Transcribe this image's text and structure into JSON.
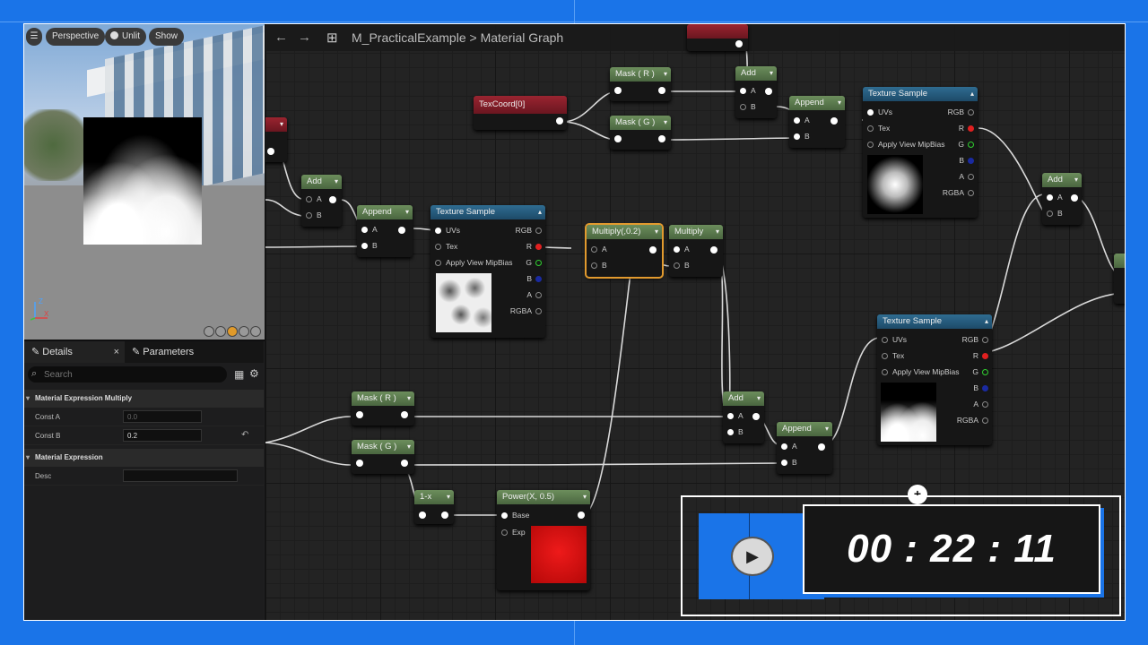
{
  "viewport": {
    "menu_icon": "hamburger-icon",
    "perspective_label": "Perspective",
    "unlit_label": "Unlit",
    "show_label": "Show",
    "axis_z": "Z",
    "axis_x": "X"
  },
  "details": {
    "tab_details": "Details",
    "tab_parameters": "Parameters",
    "close_glyph": "×",
    "search_placeholder": "Search",
    "category_multiply": "Material Expression Multiply",
    "const_a_label": "Const A",
    "const_a_value": "0.0",
    "const_b_label": "Const B",
    "const_b_value": "0.2",
    "category_expression": "Material Expression",
    "desc_label": "Desc",
    "desc_value": ""
  },
  "graph": {
    "asset_name": "M_PracticalExample",
    "separator": ">",
    "graph_name": "Material Graph",
    "nodes": {
      "texcoord": "TexCoord[0]",
      "mask_r_top": "Mask ( R )",
      "mask_g_top": "Mask ( G )",
      "add_top": "Add",
      "append_top": "Append",
      "texsample_top": "Texture Sample",
      "add_right": "Add",
      "add_left": "Add",
      "append_left": "Append",
      "texsample_mid": "Texture Sample",
      "multiply_02": "Multiply(,0.2)",
      "multiply": "Multiply",
      "mask_r_bot": "Mask ( R )",
      "mask_g_bot": "Mask ( G )",
      "one_minus": "1-x",
      "power": "Power(X, 0.5)",
      "add_bot": "Add",
      "append_bot": "Append",
      "texsample_bot": "Texture Sample"
    },
    "pins": {
      "a": "A",
      "b": "B",
      "uvs": "UVs",
      "tex": "Tex",
      "mip": "Apply View MipBias",
      "rgb": "RGB",
      "r": "R",
      "g": "G",
      "bch": "B",
      "alpha": "A",
      "rgba": "RGBA",
      "base": "Base",
      "exp": "Exp"
    }
  },
  "overlay": {
    "timer": "00 : 22 : 11",
    "plus": "+"
  },
  "colors": {
    "brand_blue": "#1a74e8",
    "selection_orange": "#e29a2e",
    "tex_header": "#2f6c91",
    "math_header": "#6c8e5c",
    "coord_header": "#9a2430"
  }
}
